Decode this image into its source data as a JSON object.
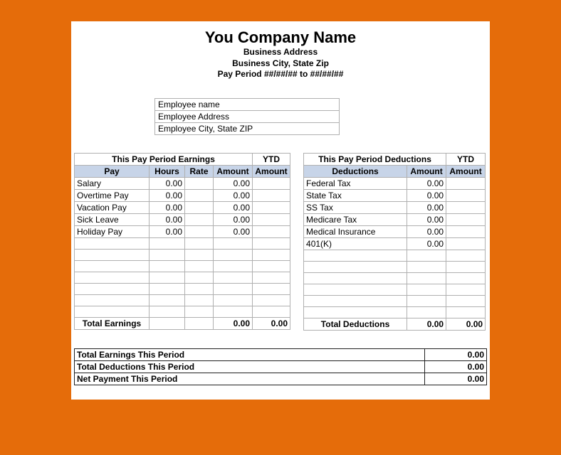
{
  "header": {
    "company": "You Company Name",
    "address": "Business Address",
    "citystatezip": "Business City, State  Zip",
    "payperiod": "Pay Period ##/##/## to ##/##/##"
  },
  "employee": {
    "name": "Employee name",
    "address": "Employee Address",
    "citystatezip": "Employee City, State  ZIP"
  },
  "earnings": {
    "section_title": "This Pay Period Earnings",
    "ytd_label": "YTD",
    "col_pay": "Pay",
    "col_hours": "Hours",
    "col_rate": "Rate",
    "col_amount": "Amount",
    "col_ytd_amount": "Amount",
    "rows": [
      {
        "label": "Salary",
        "hours": "0.00",
        "rate": "",
        "amount": "0.00",
        "ytd": ""
      },
      {
        "label": "Overtime Pay",
        "hours": "0.00",
        "rate": "",
        "amount": "0.00",
        "ytd": ""
      },
      {
        "label": "Vacation Pay",
        "hours": "0.00",
        "rate": "",
        "amount": "0.00",
        "ytd": ""
      },
      {
        "label": "Sick Leave",
        "hours": "0.00",
        "rate": "",
        "amount": "0.00",
        "ytd": ""
      },
      {
        "label": "Holiday Pay",
        "hours": "0.00",
        "rate": "",
        "amount": "0.00",
        "ytd": ""
      }
    ],
    "total_label": "Total Earnings",
    "total_amount": "0.00",
    "total_ytd": "0.00"
  },
  "deductions": {
    "section_title": "This Pay Period Deductions",
    "ytd_label": "YTD",
    "col_ded": "Deductions",
    "col_amount": "Amount",
    "col_ytd_amount": "Amount",
    "rows": [
      {
        "label": "Federal Tax",
        "amount": "0.00",
        "ytd": ""
      },
      {
        "label": "State Tax",
        "amount": "0.00",
        "ytd": ""
      },
      {
        "label": "SS Tax",
        "amount": "0.00",
        "ytd": ""
      },
      {
        "label": "Medicare Tax",
        "amount": "0.00",
        "ytd": ""
      },
      {
        "label": "Medical Insurance",
        "amount": "0.00",
        "ytd": ""
      },
      {
        "label": "401(K)",
        "amount": "0.00",
        "ytd": ""
      }
    ],
    "total_label": "Total Deductions",
    "total_amount": "0.00",
    "total_ytd": "0.00"
  },
  "summary": {
    "total_earnings_label": "Total Earnings This Period",
    "total_earnings_value": "0.00",
    "total_deductions_label": "Total Deductions This Period",
    "total_deductions_value": "0.00",
    "net_payment_label": "Net Payment This Period",
    "net_payment_value": "0.00"
  },
  "blank_rows_earnings": 7,
  "blank_rows_deductions": 6
}
